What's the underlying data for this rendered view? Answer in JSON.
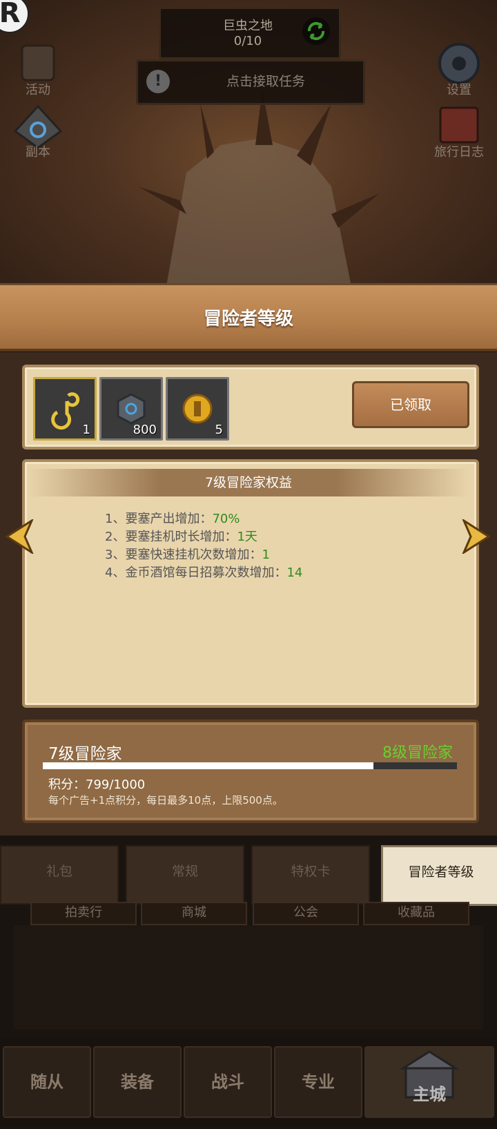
{
  "top": {
    "zone_name": "巨虫之地",
    "zone_progress": "0/10",
    "quest_text": "点击接取任务",
    "left_buttons": [
      {
        "label": "活动",
        "icon": "armor-icon"
      },
      {
        "label": "副本",
        "icon": "portal-icon"
      }
    ],
    "right_buttons": [
      {
        "label": "设置",
        "icon": "gear-icon"
      },
      {
        "label": "旅行日志",
        "icon": "book-icon"
      }
    ]
  },
  "panel": {
    "title": "冒险者等级",
    "rewards": [
      {
        "icon": "hook-icon",
        "count": "1"
      },
      {
        "icon": "rune-stone-icon",
        "count": "800"
      },
      {
        "icon": "gold-coin-icon",
        "count": "5"
      }
    ],
    "claim_label": "已领取",
    "benefits_title": "7级冒险家权益",
    "benefits": [
      {
        "text": "1、要塞产出增加：",
        "value": "70%"
      },
      {
        "text": "2、要塞挂机时长增加：",
        "value": "1天"
      },
      {
        "text": "3、要塞快速挂机次数增加：",
        "value": "1"
      },
      {
        "text": "4、金币酒馆每日招募次数增加：",
        "value": "14"
      }
    ],
    "current_level": "7级冒险家",
    "next_level": "8级冒险家",
    "progress_fraction": 0.799,
    "score_text": "积分：799/1000",
    "hint": "每个广告+1点积分，每日最多10点，上限500点。"
  },
  "tabs": [
    "礼包",
    "常规",
    "特权卡",
    "冒险者等级"
  ],
  "subtabs": [
    "拍卖行",
    "商城",
    "公会",
    "收藏品"
  ],
  "nav": [
    "随从",
    "装备",
    "战斗",
    "专业",
    "主城"
  ],
  "colors": {
    "accent_green": "#2e8b1f",
    "next_level_green": "#6ad02e"
  }
}
